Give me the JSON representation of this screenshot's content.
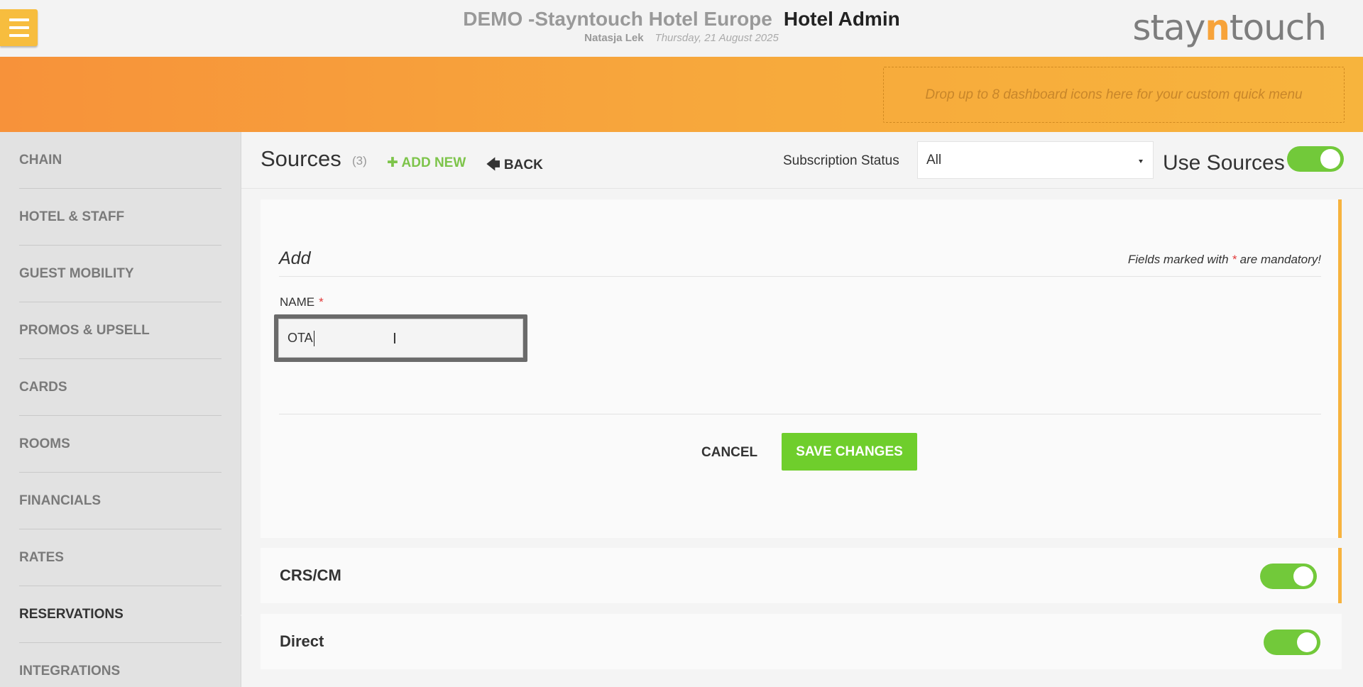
{
  "header": {
    "hotel_name": "DEMO -Stayntouch Hotel Europe",
    "app_name": "Hotel Admin",
    "user": "Natasja Lek",
    "date": "Thursday, 21 August 2025",
    "logo": {
      "pre": "stay",
      "n": "n",
      "post": "touch"
    }
  },
  "banner": {
    "dropzone_text": "Drop up to 8 dashboard icons here for your custom quick menu"
  },
  "sidebar": {
    "items": [
      {
        "label": "CHAIN"
      },
      {
        "label": "HOTEL & STAFF"
      },
      {
        "label": "GUEST MOBILITY"
      },
      {
        "label": "PROMOS & UPSELL"
      },
      {
        "label": "CARDS"
      },
      {
        "label": "ROOMS"
      },
      {
        "label": "FINANCIALS"
      },
      {
        "label": "RATES"
      },
      {
        "label": "RESERVATIONS",
        "active": true
      },
      {
        "label": "INTEGRATIONS"
      }
    ]
  },
  "page": {
    "title": "Sources",
    "count": "(3)",
    "add_new": "ADD NEW",
    "back": "BACK",
    "subscription_label": "Subscription Status",
    "subscription_value": "All",
    "use_sources_label": "Use Sources",
    "use_sources_on": true
  },
  "form": {
    "title": "Add",
    "mandatory_pre": "Fields marked with",
    "mandatory_star": "*",
    "mandatory_post": "are mandatory!",
    "name_label": "NAME",
    "name_star": "*",
    "name_value": "OTA",
    "cancel": "CANCEL",
    "save": "SAVE CHANGES"
  },
  "sources": [
    {
      "label": "CRS/CM",
      "enabled": true
    },
    {
      "label": "Direct",
      "enabled": true
    }
  ],
  "colors": {
    "accent_orange": "#f7a33a",
    "toggle_green": "#72c93a",
    "save_green": "#6fce2c",
    "add_new_green": "#7dc44a",
    "menu_yellow": "#f7bd3e"
  }
}
